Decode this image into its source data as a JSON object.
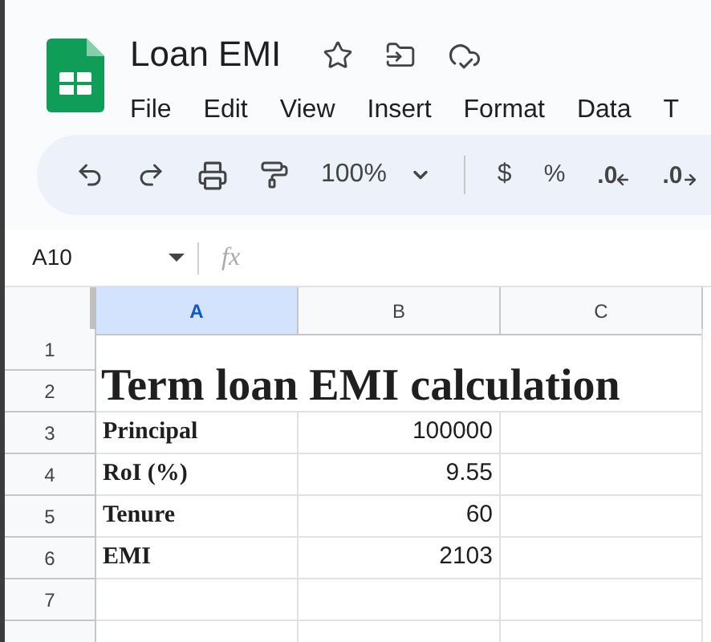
{
  "document": {
    "title": "Loan EMI"
  },
  "menus": [
    "File",
    "Edit",
    "View",
    "Insert",
    "Format",
    "Data",
    "T"
  ],
  "toolbar": {
    "zoom": "100%",
    "currency": "$",
    "percent": "%",
    "decrease_decimal": ".0",
    "increase_decimal": ".0"
  },
  "name_box": "A10",
  "formula_label": "fx",
  "columns": [
    {
      "label": "A",
      "selected": true
    },
    {
      "label": "B",
      "selected": false
    },
    {
      "label": "C",
      "selected": false
    }
  ],
  "merged_title": "Term loan EMI calculation",
  "rows": [
    {
      "number": "1",
      "cells": []
    },
    {
      "number": "2",
      "cells": []
    },
    {
      "number": "3",
      "cells": [
        "Principal",
        "100000"
      ]
    },
    {
      "number": "4",
      "cells": [
        "RoI (%)",
        "9.55"
      ]
    },
    {
      "number": "5",
      "cells": [
        "Tenure",
        "60"
      ]
    },
    {
      "number": "6",
      "cells": [
        "EMI",
        "2103"
      ]
    },
    {
      "number": "7",
      "cells": []
    }
  ]
}
